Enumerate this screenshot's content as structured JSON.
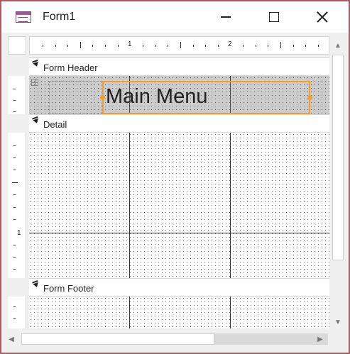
{
  "window": {
    "title": "Form1",
    "icon": "access-form-icon"
  },
  "ruler": {
    "marks": [
      "1",
      "2"
    ],
    "vertical_marks": [
      "1"
    ]
  },
  "sections": {
    "header": "Form Header",
    "detail": "Detail",
    "footer": "Form Footer"
  },
  "controls": {
    "title_label": "Main Menu"
  },
  "colors": {
    "selection": "#f0a030",
    "window_border": "#b25a63",
    "header_background": "#cccccc"
  }
}
